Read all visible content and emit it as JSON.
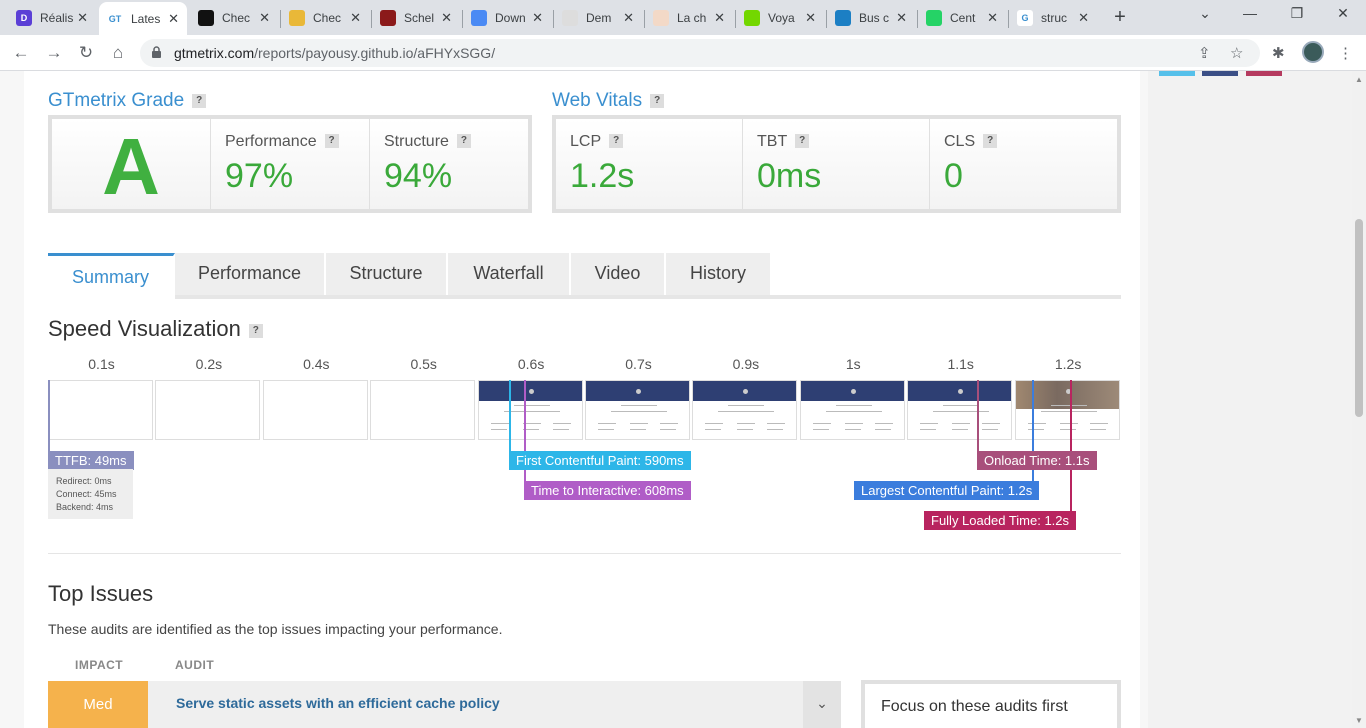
{
  "browser": {
    "tabs": [
      {
        "label": "Réalis",
        "fav_color": "#5b3fd6",
        "fav_text": "D"
      },
      {
        "label": "Lates",
        "fav_color": "#ffffff",
        "fav_text": "GT",
        "active": true
      },
      {
        "label": "Chec",
        "fav_color": "#111111",
        "fav_text": ""
      },
      {
        "label": "Chec",
        "fav_color": "#e9b838",
        "fav_text": ""
      },
      {
        "label": "Schel",
        "fav_color": "#8b1a1a",
        "fav_text": ""
      },
      {
        "label": "Down",
        "fav_color": "#4a8af4",
        "fav_text": ""
      },
      {
        "label": "Dem",
        "fav_color": "#dddddd",
        "fav_text": ""
      },
      {
        "label": "La ch",
        "fav_color": "#f3d9c7",
        "fav_text": ""
      },
      {
        "label": "Voya",
        "fav_color": "#73d700",
        "fav_text": ""
      },
      {
        "label": "Bus c",
        "fav_color": "#1c7fc4",
        "fav_text": ""
      },
      {
        "label": "Cent",
        "fav_color": "#25d366",
        "fav_text": ""
      },
      {
        "label": "struc",
        "fav_color": "#ffffff",
        "fav_text": "G"
      }
    ],
    "new_tab": "+",
    "url_host": "gtmetrix.com",
    "url_path": "/reports/payousy.github.io/aFHYxSGG/"
  },
  "grade": {
    "title": "GTmetrix Grade",
    "letter": "A",
    "performance_label": "Performance",
    "performance_value": "97%",
    "structure_label": "Structure",
    "structure_value": "94%"
  },
  "vitals": {
    "title": "Web Vitals",
    "lcp_label": "LCP",
    "lcp_value": "1.2s",
    "tbt_label": "TBT",
    "tbt_value": "0ms",
    "cls_label": "CLS",
    "cls_value": "0"
  },
  "help_mark": "?",
  "report_tabs": [
    "Summary",
    "Performance",
    "Structure",
    "Waterfall",
    "Video",
    "History"
  ],
  "speed": {
    "title": "Speed Visualization",
    "times": [
      "0.1s",
      "0.2s",
      "0.4s",
      "0.5s",
      "0.6s",
      "0.7s",
      "0.9s",
      "1s",
      "1.1s",
      "1.2s"
    ],
    "ttfb": "TTFB: 49ms",
    "redirect": "Redirect: 0ms",
    "connect": "Connect: 45ms",
    "backend": "Backend: 4ms",
    "fcp": "First Contentful Paint: 590ms",
    "tti": "Time to Interactive: 608ms",
    "onload": "Onload Time: 1.1s",
    "lcp": "Largest Contentful Paint: 1.2s",
    "fully_loaded": "Fully Loaded Time: 1.2s",
    "colors": {
      "ttfb": "#8a8fbf",
      "fcp": "#2db6e8",
      "tti": "#b05dc7",
      "onload": "#a84f7b",
      "lcp": "#3b7ddd",
      "fully": "#b8245f"
    }
  },
  "issues": {
    "title": "Top Issues",
    "description": "These audits are identified as the top issues impacting your performance.",
    "col_impact": "IMPACT",
    "col_audit": "AUDIT",
    "rows": [
      {
        "impact": "Med",
        "audit": "Serve static assets with an efficient cache policy"
      }
    ],
    "focus_title": "Focus on these audits first"
  }
}
